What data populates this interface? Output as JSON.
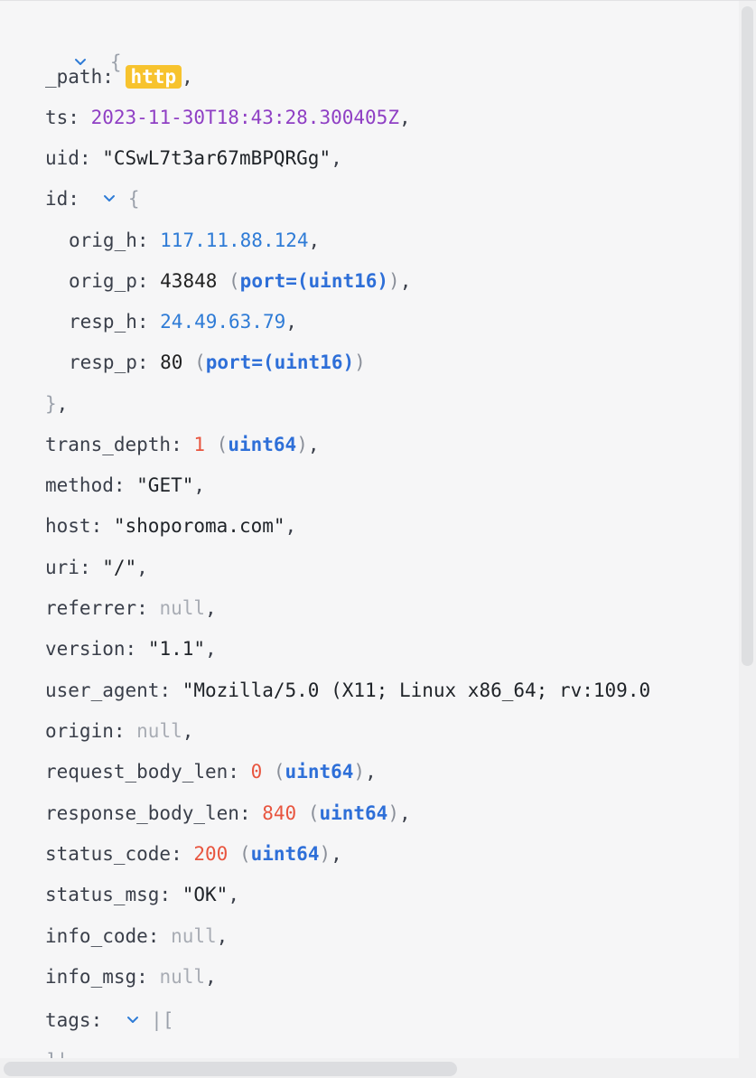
{
  "record": {
    "open_brace": "{",
    "path": {
      "key": "_path",
      "value": "http"
    },
    "ts": {
      "key": "ts",
      "value": "2023-11-30T18:43:28.300405Z"
    },
    "uid": {
      "key": "uid",
      "value": "\"CSwL7t3ar67mBPQRGg\""
    },
    "id": {
      "key": "id",
      "open_brace": "{",
      "close_brace": "}",
      "orig_h": {
        "key": "orig_h",
        "value": "117.11.88.124"
      },
      "orig_p": {
        "key": "orig_p",
        "value": "43848",
        "type": "port=(uint16)"
      },
      "resp_h": {
        "key": "resp_h",
        "value": "24.49.63.79"
      },
      "resp_p": {
        "key": "resp_p",
        "value": "80",
        "type": "port=(uint16)"
      }
    },
    "trans_depth": {
      "key": "trans_depth",
      "value": "1",
      "type": "uint64"
    },
    "method": {
      "key": "method",
      "value": "\"GET\""
    },
    "host": {
      "key": "host",
      "value": "\"shoporoma.com\""
    },
    "uri": {
      "key": "uri",
      "value": "\"/\""
    },
    "referrer": {
      "key": "referrer",
      "value": "null"
    },
    "version": {
      "key": "version",
      "value": "\"1.1\""
    },
    "user_agent": {
      "key": "user_agent",
      "value": "\"Mozilla/5.0 (X11; Linux x86_64; rv:109.0"
    },
    "origin": {
      "key": "origin",
      "value": "null"
    },
    "request_body_len": {
      "key": "request_body_len",
      "value": "0",
      "type": "uint64"
    },
    "response_body_len": {
      "key": "response_body_len",
      "value": "840",
      "type": "uint64"
    },
    "status_code": {
      "key": "status_code",
      "value": "200",
      "type": "uint64"
    },
    "status_msg": {
      "key": "status_msg",
      "value": "\"OK\""
    },
    "info_code": {
      "key": "info_code",
      "value": "null"
    },
    "info_msg": {
      "key": "info_msg",
      "value": "null"
    },
    "tags": {
      "key": "tags",
      "open": "|[",
      "close": "]|"
    }
  },
  "colors": {
    "background": "#f6f6f7",
    "badge": "#f7c32e",
    "ip": "#2e7bd6",
    "date": "#8f3fc4",
    "number_accent": "#e8553f",
    "type": "#2e6fd8",
    "null": "#a8acb4"
  },
  "icons": {
    "expand": "chevron-down-icon"
  }
}
